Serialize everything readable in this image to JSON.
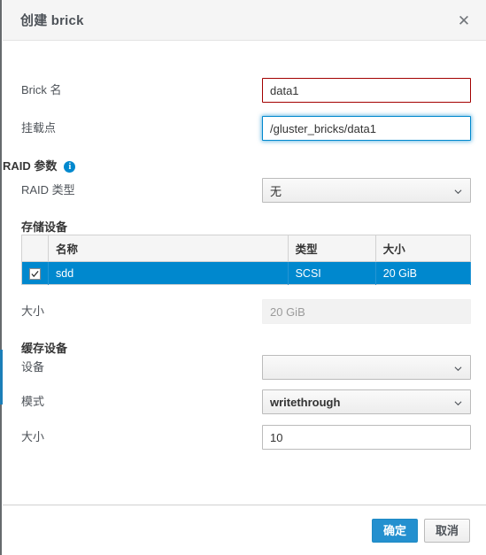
{
  "dialog": {
    "title": "创建 brick",
    "close_label": "✕"
  },
  "fields": {
    "brick_name": {
      "label": "Brick 名",
      "value": "data1",
      "placeholder": ""
    },
    "mount_point": {
      "label": "挂载点",
      "value": "/gluster_bricks/data1",
      "placeholder": ""
    }
  },
  "raid_section": {
    "heading": "RAID 参数",
    "info_glyph": "i",
    "raid_type": {
      "label": "RAID 类型",
      "value": "无"
    }
  },
  "storage_section": {
    "heading": "存储设备",
    "table": {
      "columns": [
        "",
        "名称",
        "类型",
        "大小"
      ],
      "rows": [
        {
          "checked": true,
          "name": "sdd",
          "type": "SCSI",
          "size": "20 GiB"
        }
      ]
    },
    "size": {
      "label": "大小",
      "value": "20 GiB"
    }
  },
  "cache_section": {
    "heading": "缓存设备",
    "device": {
      "label": "设备",
      "value": ""
    },
    "mode": {
      "label": "模式",
      "value": "writethrough"
    },
    "size": {
      "label": "大小",
      "value": "10"
    }
  },
  "footer": {
    "confirm_label": "确定",
    "cancel_label": "取消"
  },
  "colors": {
    "accent": "#0088ce",
    "primary_button": "#2490cf",
    "error_border": "#a30000",
    "row_selected": "#0088ce",
    "header_bg": "#f5f5f5"
  }
}
